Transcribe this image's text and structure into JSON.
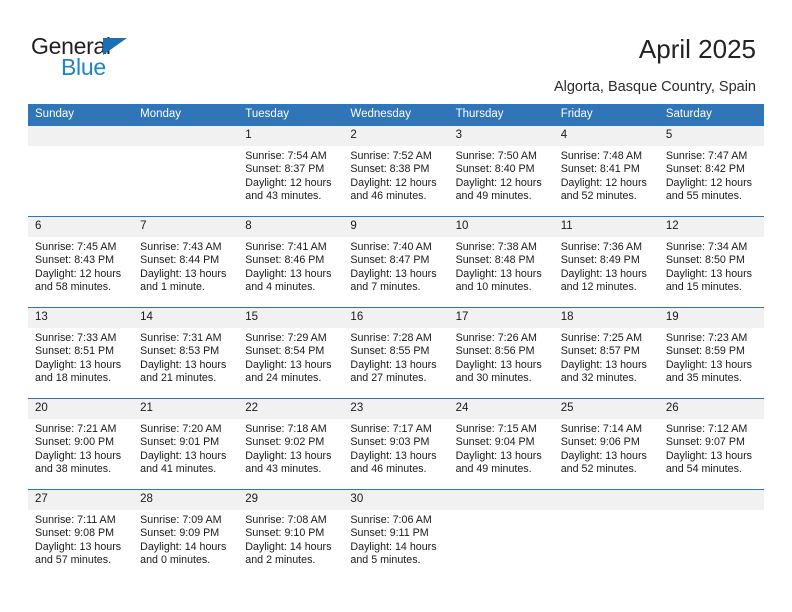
{
  "brand": {
    "name_top": "General",
    "name_bottom": "Blue",
    "triangle_color": "#1a6fb5",
    "blue_text_color": "#1d84d1"
  },
  "header": {
    "title": "April 2025",
    "location": "Algorta, Basque Country, Spain"
  },
  "theme": {
    "header_blue": "#3075b8",
    "daynum_band": "#f1f1f1",
    "text": "#1a1a1a"
  },
  "calendar": {
    "weekday_headers": [
      "Sunday",
      "Monday",
      "Tuesday",
      "Wednesday",
      "Thursday",
      "Friday",
      "Saturday"
    ],
    "weeks": [
      [
        {
          "day": ""
        },
        {
          "day": ""
        },
        {
          "day": "1",
          "sunrise": "Sunrise: 7:54 AM",
          "sunset": "Sunset: 8:37 PM",
          "daylight": "Daylight: 12 hours and 43 minutes."
        },
        {
          "day": "2",
          "sunrise": "Sunrise: 7:52 AM",
          "sunset": "Sunset: 8:38 PM",
          "daylight": "Daylight: 12 hours and 46 minutes."
        },
        {
          "day": "3",
          "sunrise": "Sunrise: 7:50 AM",
          "sunset": "Sunset: 8:40 PM",
          "daylight": "Daylight: 12 hours and 49 minutes."
        },
        {
          "day": "4",
          "sunrise": "Sunrise: 7:48 AM",
          "sunset": "Sunset: 8:41 PM",
          "daylight": "Daylight: 12 hours and 52 minutes."
        },
        {
          "day": "5",
          "sunrise": "Sunrise: 7:47 AM",
          "sunset": "Sunset: 8:42 PM",
          "daylight": "Daylight: 12 hours and 55 minutes."
        }
      ],
      [
        {
          "day": "6",
          "sunrise": "Sunrise: 7:45 AM",
          "sunset": "Sunset: 8:43 PM",
          "daylight": "Daylight: 12 hours and 58 minutes."
        },
        {
          "day": "7",
          "sunrise": "Sunrise: 7:43 AM",
          "sunset": "Sunset: 8:44 PM",
          "daylight": "Daylight: 13 hours and 1 minute."
        },
        {
          "day": "8",
          "sunrise": "Sunrise: 7:41 AM",
          "sunset": "Sunset: 8:46 PM",
          "daylight": "Daylight: 13 hours and 4 minutes."
        },
        {
          "day": "9",
          "sunrise": "Sunrise: 7:40 AM",
          "sunset": "Sunset: 8:47 PM",
          "daylight": "Daylight: 13 hours and 7 minutes."
        },
        {
          "day": "10",
          "sunrise": "Sunrise: 7:38 AM",
          "sunset": "Sunset: 8:48 PM",
          "daylight": "Daylight: 13 hours and 10 minutes."
        },
        {
          "day": "11",
          "sunrise": "Sunrise: 7:36 AM",
          "sunset": "Sunset: 8:49 PM",
          "daylight": "Daylight: 13 hours and 12 minutes."
        },
        {
          "day": "12",
          "sunrise": "Sunrise: 7:34 AM",
          "sunset": "Sunset: 8:50 PM",
          "daylight": "Daylight: 13 hours and 15 minutes."
        }
      ],
      [
        {
          "day": "13",
          "sunrise": "Sunrise: 7:33 AM",
          "sunset": "Sunset: 8:51 PM",
          "daylight": "Daylight: 13 hours and 18 minutes."
        },
        {
          "day": "14",
          "sunrise": "Sunrise: 7:31 AM",
          "sunset": "Sunset: 8:53 PM",
          "daylight": "Daylight: 13 hours and 21 minutes."
        },
        {
          "day": "15",
          "sunrise": "Sunrise: 7:29 AM",
          "sunset": "Sunset: 8:54 PM",
          "daylight": "Daylight: 13 hours and 24 minutes."
        },
        {
          "day": "16",
          "sunrise": "Sunrise: 7:28 AM",
          "sunset": "Sunset: 8:55 PM",
          "daylight": "Daylight: 13 hours and 27 minutes."
        },
        {
          "day": "17",
          "sunrise": "Sunrise: 7:26 AM",
          "sunset": "Sunset: 8:56 PM",
          "daylight": "Daylight: 13 hours and 30 minutes."
        },
        {
          "day": "18",
          "sunrise": "Sunrise: 7:25 AM",
          "sunset": "Sunset: 8:57 PM",
          "daylight": "Daylight: 13 hours and 32 minutes."
        },
        {
          "day": "19",
          "sunrise": "Sunrise: 7:23 AM",
          "sunset": "Sunset: 8:59 PM",
          "daylight": "Daylight: 13 hours and 35 minutes."
        }
      ],
      [
        {
          "day": "20",
          "sunrise": "Sunrise: 7:21 AM",
          "sunset": "Sunset: 9:00 PM",
          "daylight": "Daylight: 13 hours and 38 minutes."
        },
        {
          "day": "21",
          "sunrise": "Sunrise: 7:20 AM",
          "sunset": "Sunset: 9:01 PM",
          "daylight": "Daylight: 13 hours and 41 minutes."
        },
        {
          "day": "22",
          "sunrise": "Sunrise: 7:18 AM",
          "sunset": "Sunset: 9:02 PM",
          "daylight": "Daylight: 13 hours and 43 minutes."
        },
        {
          "day": "23",
          "sunrise": "Sunrise: 7:17 AM",
          "sunset": "Sunset: 9:03 PM",
          "daylight": "Daylight: 13 hours and 46 minutes."
        },
        {
          "day": "24",
          "sunrise": "Sunrise: 7:15 AM",
          "sunset": "Sunset: 9:04 PM",
          "daylight": "Daylight: 13 hours and 49 minutes."
        },
        {
          "day": "25",
          "sunrise": "Sunrise: 7:14 AM",
          "sunset": "Sunset: 9:06 PM",
          "daylight": "Daylight: 13 hours and 52 minutes."
        },
        {
          "day": "26",
          "sunrise": "Sunrise: 7:12 AM",
          "sunset": "Sunset: 9:07 PM",
          "daylight": "Daylight: 13 hours and 54 minutes."
        }
      ],
      [
        {
          "day": "27",
          "sunrise": "Sunrise: 7:11 AM",
          "sunset": "Sunset: 9:08 PM",
          "daylight": "Daylight: 13 hours and 57 minutes."
        },
        {
          "day": "28",
          "sunrise": "Sunrise: 7:09 AM",
          "sunset": "Sunset: 9:09 PM",
          "daylight": "Daylight: 14 hours and 0 minutes."
        },
        {
          "day": "29",
          "sunrise": "Sunrise: 7:08 AM",
          "sunset": "Sunset: 9:10 PM",
          "daylight": "Daylight: 14 hours and 2 minutes."
        },
        {
          "day": "30",
          "sunrise": "Sunrise: 7:06 AM",
          "sunset": "Sunset: 9:11 PM",
          "daylight": "Daylight: 14 hours and 5 minutes."
        },
        {
          "day": ""
        },
        {
          "day": ""
        },
        {
          "day": ""
        }
      ]
    ]
  }
}
